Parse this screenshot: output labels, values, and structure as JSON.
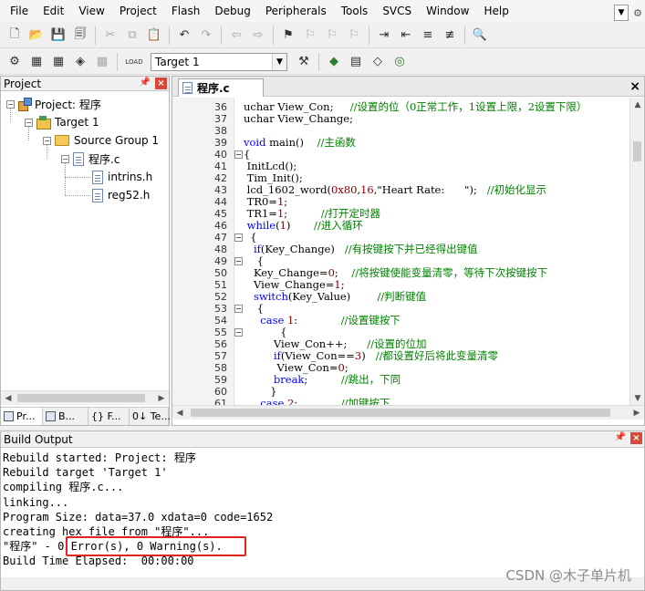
{
  "menu": [
    "File",
    "Edit",
    "View",
    "Project",
    "Flash",
    "Debug",
    "Peripherals",
    "Tools",
    "SVCS",
    "Window",
    "Help"
  ],
  "toolbar": {
    "target_select": "Target 1",
    "icons_row1": [
      "new-file-icon",
      "open-folder-icon",
      "save-icon",
      "save-all-icon",
      "cut-icon",
      "copy-icon",
      "paste-icon",
      "undo-icon",
      "redo-icon",
      "nav-back-icon",
      "nav-forward-icon",
      "bookmark-icon",
      "bookmark-prev-icon",
      "bookmark-next-icon",
      "bookmark-clear-icon",
      "indent-icon",
      "unindent-icon",
      "comment-icon",
      "uncomment-icon",
      "find-in-files-icon"
    ],
    "icons_row2": [
      "compile-icon",
      "build-icon",
      "rebuild-icon",
      "batch-build-icon",
      "stop-build-icon",
      "download-icon",
      "target-options-icon",
      "manage-components-icon",
      "select-packs-icon",
      "pack-installer-icon",
      "config-icon"
    ],
    "load_label": "LOAD"
  },
  "project_panel": {
    "title": "Project",
    "tree": [
      {
        "label": "Project: 程序",
        "level": 0,
        "expanded": true
      },
      {
        "label": "Target 1",
        "level": 1,
        "expanded": true
      },
      {
        "label": "Source Group 1",
        "level": 2,
        "expanded": true
      },
      {
        "label": "程序.c",
        "level": 3,
        "expanded": true
      },
      {
        "label": "intrins.h",
        "level": 4
      },
      {
        "label": "reg52.h",
        "level": 4
      }
    ],
    "tabs": [
      "Pr...",
      "B...",
      "{} F...",
      "0↓ Te..."
    ]
  },
  "editor": {
    "tab_label": "程序.c",
    "lines": [
      {
        "n": "36",
        "code": [
          {
            "t": "uchar View_Con;     "
          },
          {
            "t": "//设置的位（0正常工作，1设置上限，2设置下限）",
            "c": "cm"
          }
        ]
      },
      {
        "n": "37",
        "code": [
          {
            "t": "uchar View_Change;"
          }
        ]
      },
      {
        "n": "38",
        "code": []
      },
      {
        "n": "39",
        "code": [
          {
            "t": "void",
            "c": "kw"
          },
          {
            "t": " main()    "
          },
          {
            "t": "//主函数",
            "c": "cm"
          }
        ]
      },
      {
        "n": "40",
        "fold": "-",
        "code": [
          {
            "t": "{"
          }
        ]
      },
      {
        "n": "41",
        "code": [
          {
            "t": " InitLcd();"
          }
        ]
      },
      {
        "n": "42",
        "code": [
          {
            "t": " Tim_Init();"
          }
        ]
      },
      {
        "n": "43",
        "code": [
          {
            "t": " lcd_1602_word("
          },
          {
            "t": "0x80",
            "c": "num"
          },
          {
            "t": ","
          },
          {
            "t": "16",
            "c": "num"
          },
          {
            "t": ",\"Heart Rate:      \");   "
          },
          {
            "t": "//初始化显示",
            "c": "cm"
          }
        ]
      },
      {
        "n": "44",
        "code": [
          {
            "t": " TR0="
          },
          {
            "t": "1",
            "c": "num"
          },
          {
            "t": ";"
          }
        ]
      },
      {
        "n": "45",
        "code": [
          {
            "t": " TR1="
          },
          {
            "t": "1",
            "c": "num"
          },
          {
            "t": ";          "
          },
          {
            "t": "//打开定时器",
            "c": "cm"
          }
        ]
      },
      {
        "n": "46",
        "code": [
          {
            "t": " "
          },
          {
            "t": "while",
            "c": "kw"
          },
          {
            "t": "("
          },
          {
            "t": "1",
            "c": "num"
          },
          {
            "t": ")       "
          },
          {
            "t": "//进入循环",
            "c": "cm"
          }
        ]
      },
      {
        "n": "47",
        "fold": "-",
        "code": [
          {
            "t": "  {"
          }
        ]
      },
      {
        "n": "48",
        "code": [
          {
            "t": "   "
          },
          {
            "t": "if",
            "c": "kw"
          },
          {
            "t": "(Key_Change)   "
          },
          {
            "t": "//有按键按下并已经得出键值",
            "c": "cm"
          }
        ]
      },
      {
        "n": "49",
        "fold": "-",
        "code": [
          {
            "t": "    {"
          }
        ]
      },
      {
        "n": "50",
        "code": [
          {
            "t": "   Key_Change="
          },
          {
            "t": "0",
            "c": "num"
          },
          {
            "t": ";    "
          },
          {
            "t": "//将按键使能变量清零，等待下次按键按下",
            "c": "cm"
          }
        ]
      },
      {
        "n": "51",
        "code": [
          {
            "t": "   View_Change="
          },
          {
            "t": "1",
            "c": "num"
          },
          {
            "t": ";"
          }
        ]
      },
      {
        "n": "52",
        "code": [
          {
            "t": "   "
          },
          {
            "t": "switch",
            "c": "kw"
          },
          {
            "t": "(Key_Value)        "
          },
          {
            "t": "//判断键值",
            "c": "cm"
          }
        ]
      },
      {
        "n": "53",
        "fold": "-",
        "code": [
          {
            "t": "    {"
          }
        ]
      },
      {
        "n": "54",
        "code": [
          {
            "t": "     "
          },
          {
            "t": "case",
            "c": "kw"
          },
          {
            "t": " "
          },
          {
            "t": "1",
            "c": "num"
          },
          {
            "t": ":             "
          },
          {
            "t": "//设置键按下",
            "c": "cm"
          }
        ]
      },
      {
        "n": "55",
        "fold": "-",
        "code": [
          {
            "t": "           {"
          }
        ]
      },
      {
        "n": "56",
        "code": [
          {
            "t": "         View_Con++;      "
          },
          {
            "t": "//设置的位加",
            "c": "cm"
          }
        ]
      },
      {
        "n": "57",
        "code": [
          {
            "t": "         "
          },
          {
            "t": "if",
            "c": "kw"
          },
          {
            "t": "(View_Con=="
          },
          {
            "t": "3",
            "c": "num"
          },
          {
            "t": ")   "
          },
          {
            "t": "//都设置好后将此变量清零",
            "c": "cm"
          }
        ]
      },
      {
        "n": "58",
        "code": [
          {
            "t": "          View_Con="
          },
          {
            "t": "0",
            "c": "num"
          },
          {
            "t": ";"
          }
        ]
      },
      {
        "n": "59",
        "code": [
          {
            "t": "         "
          },
          {
            "t": "break",
            "c": "kw"
          },
          {
            "t": ";          "
          },
          {
            "t": "//跳出，下同",
            "c": "cm"
          }
        ]
      },
      {
        "n": "60",
        "code": [
          {
            "t": "        }"
          }
        ]
      },
      {
        "n": "61",
        "code": [
          {
            "t": "     "
          },
          {
            "t": "case",
            "c": "kw"
          },
          {
            "t": " "
          },
          {
            "t": "2",
            "c": "num"
          },
          {
            "t": ":             "
          },
          {
            "t": "//加键按下",
            "c": "cm"
          }
        ]
      }
    ]
  },
  "build_output": {
    "title": "Build Output",
    "lines": [
      "Rebuild started: Project: 程序",
      "Rebuild target 'Target 1'",
      "compiling 程序.c...",
      "linking...",
      "Program Size: data=37.0 xdata=0 code=1652",
      "creating hex file from \"程序\"...",
      "\"程序\" - 0 Error(s), 0 Warning(s).",
      "Build Time Elapsed:  00:00:00"
    ],
    "watermark_credit": "CSDN @木子单片机"
  }
}
